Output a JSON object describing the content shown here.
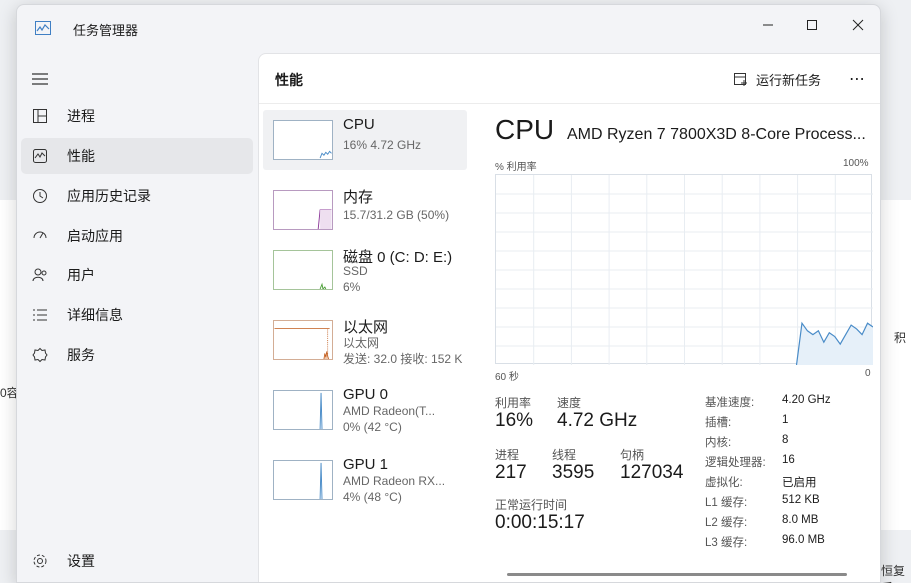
{
  "window": {
    "title": "任务管理器"
  },
  "nav": {
    "items": [
      {
        "label": "进程",
        "icon": "processes-icon"
      },
      {
        "label": "性能",
        "icon": "performance-icon",
        "active": true
      },
      {
        "label": "应用历史记录",
        "icon": "history-icon"
      },
      {
        "label": "启动应用",
        "icon": "startup-icon"
      },
      {
        "label": "用户",
        "icon": "users-icon"
      },
      {
        "label": "详细信息",
        "icon": "details-icon"
      },
      {
        "label": "服务",
        "icon": "services-icon"
      }
    ],
    "settings": "设置"
  },
  "header": {
    "title": "性能",
    "run_new_task": "运行新任务",
    "more": "⋯"
  },
  "devices": [
    {
      "name": "CPU",
      "line1": "16% 4.72 GHz",
      "line2": ""
    },
    {
      "name": "内存",
      "line1": "15.7/31.2 GB (50%)",
      "line2": ""
    },
    {
      "name": "磁盘 0 (C: D: E:)",
      "line1": "SSD",
      "line2": "6%"
    },
    {
      "name": "以太网",
      "line1": "以太网",
      "line2": "发送: 32.0 接收: 152 K"
    },
    {
      "name": "GPU 0",
      "line1": "AMD Radeon(T...",
      "line2": "0% (42 °C)"
    },
    {
      "name": "GPU 1",
      "line1": "AMD Radeon RX...",
      "line2": "4% (48 °C)"
    }
  ],
  "detail": {
    "title": "CPU",
    "model": "AMD Ryzen 7 7800X3D 8-Core Process...",
    "util_label": "% 利用率",
    "max_label": "100%",
    "time_left": "60 秒",
    "time_right": "0",
    "stats": {
      "utilization_label": "利用率",
      "utilization": "16%",
      "speed_label": "速度",
      "speed": "4.72 GHz",
      "processes_label": "进程",
      "processes": "217",
      "threads_label": "线程",
      "threads": "3595",
      "handles_label": "句柄",
      "handles": "127034",
      "uptime_label": "正常运行时间",
      "uptime": "0:00:15:17"
    },
    "specs": [
      {
        "k": "基准速度:",
        "v": "4.20 GHz"
      },
      {
        "k": "插槽:",
        "v": "1"
      },
      {
        "k": "内核:",
        "v": "8"
      },
      {
        "k": "逻辑处理器:",
        "v": "16"
      },
      {
        "k": "虚拟化:",
        "v": "已启用"
      },
      {
        "k": "L1 缓存:",
        "v": "512 KB"
      },
      {
        "k": "L2 缓存:",
        "v": "8.0 MB"
      },
      {
        "k": "L3 缓存:",
        "v": "96.0 MB"
      }
    ],
    "cpu_history_percent": [
      0,
      0,
      0,
      0,
      0,
      0,
      0,
      0,
      0,
      0,
      0,
      0,
      0,
      0,
      0,
      0,
      0,
      0,
      0,
      0,
      0,
      0,
      0,
      0,
      0,
      0,
      0,
      0,
      0,
      0,
      0,
      0,
      0,
      0,
      0,
      0,
      0,
      0,
      0,
      0,
      0,
      0,
      0,
      0,
      0,
      0,
      0,
      0,
      0,
      0,
      0,
      0,
      0,
      0,
      0,
      0,
      22,
      18,
      16,
      18,
      12,
      17,
      15,
      11,
      16,
      21,
      19,
      16,
      22,
      20
    ]
  },
  "background": {
    "left_text": "0容",
    "right_text1": "积",
    "right_text2": "恒复后"
  },
  "colors": {
    "cpu_line": "#4a8cc8",
    "memory_line": "#8e3b9b",
    "disk_line": "#4ea03a",
    "ethernet_line": "#c05a1a",
    "gpu_line": "#4a8cc8"
  }
}
